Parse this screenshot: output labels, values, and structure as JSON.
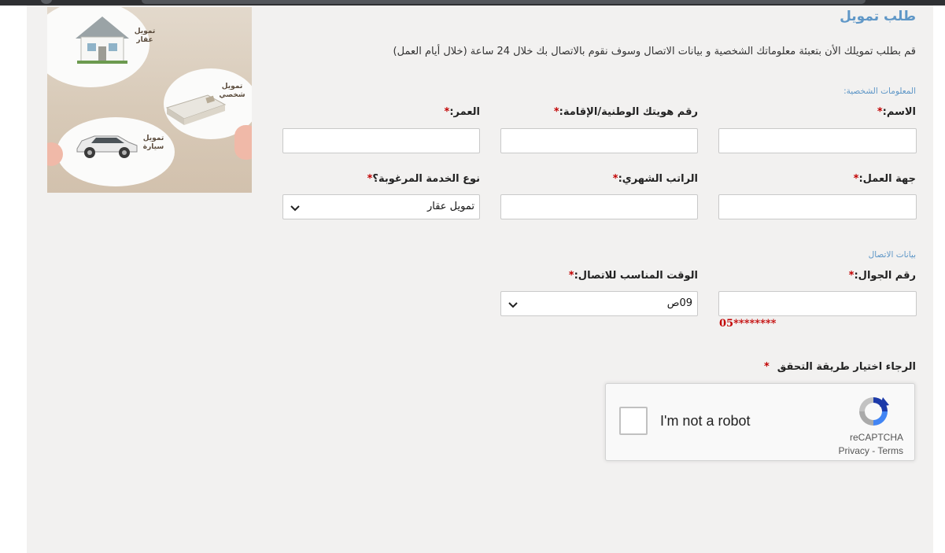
{
  "form": {
    "title": "طلب تمويل",
    "intro": "قم بطلب تمويلك الأن بتعبئة معلوماتك الشخصية و بيانات الاتصال وسوف نقوم بالاتصال بك خلال 24 ساعة (خلال أيام العمل)",
    "required_mark": "*",
    "personal_section": "المعلومات الشخصية:",
    "contact_section": "بيانات الاتصال",
    "fields": {
      "name": "الاسم:",
      "national_id": "رقم هويتك الوطنية/الإقامة:",
      "age": "العمر:",
      "employer": "جهة العمل:",
      "salary": "الراتب الشهري:",
      "service_type": "نوع الخدمة المرغوبة؟",
      "mobile": "رقم الجوال:",
      "contact_time": "الوقت المناسب للاتصال:"
    },
    "service_type_value": "تمويل عقار",
    "contact_time_value": "09ص",
    "mobile_hint": "05********",
    "verify_label": "الرجاء اختيار طريقة التحقق"
  },
  "promo": {
    "real_estate": "تمويل عقار",
    "personal": "تمويل شخصي",
    "car": "تمويل سيارة"
  },
  "recaptcha": {
    "checkbox_label": "I'm not a robot",
    "brand": "reCAPTCHA",
    "privacy": "Privacy",
    "separator": " - ",
    "terms": "Terms"
  },
  "colors": {
    "accent_blue": "#5f97c7",
    "required_red": "#c20000",
    "panel_bg": "#f2f1f0"
  }
}
